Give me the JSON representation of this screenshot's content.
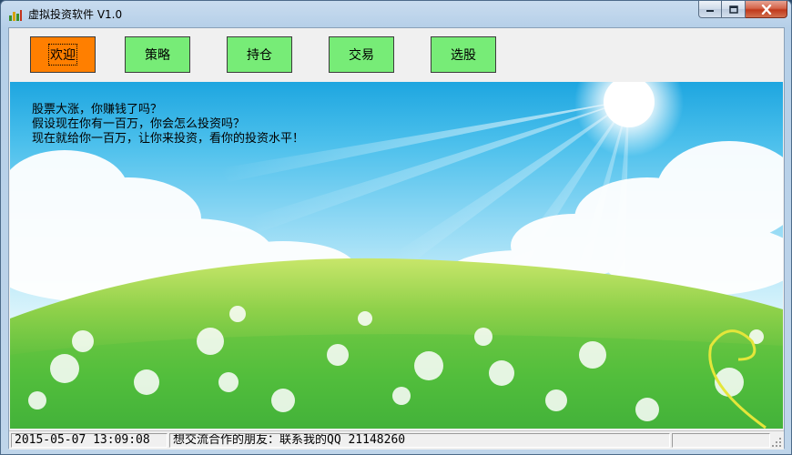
{
  "window": {
    "title": "虚拟投资软件 V1.0",
    "icon": "stock-chart-app-icon"
  },
  "caption_buttons": {
    "minimize_icon": "minimize-icon",
    "maximize_icon": "maximize-icon",
    "close_icon": "close-icon"
  },
  "toolbar": {
    "buttons": [
      {
        "label": "欢迎",
        "active": true
      },
      {
        "label": "策略",
        "active": false
      },
      {
        "label": "持仓",
        "active": false
      },
      {
        "label": "交易",
        "active": false
      },
      {
        "label": "选股",
        "active": false
      }
    ]
  },
  "welcome": {
    "lines": [
      "股票大涨，你赚钱了吗？",
      "假设现在你有一百万，你会怎么投资吗？",
      "现在就给你一百万，让你来投资，看你的投资水平！"
    ]
  },
  "statusbar": {
    "datetime": "2015-05-07 13:09:08",
    "message": "想交流合作的朋友：联系我的QQ 21148260",
    "extra": ""
  },
  "colors": {
    "active_button": "#ff7f00",
    "inactive_button": "#77ec77"
  }
}
